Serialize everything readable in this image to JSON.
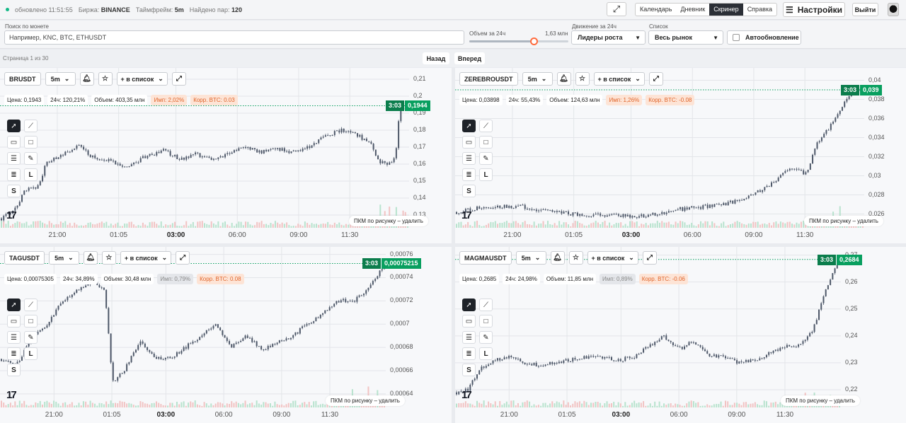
{
  "header": {
    "status": "обновлено 11:51:55",
    "exchange_label": "Биржа:",
    "exchange_value": "BINANCE",
    "timeframe_label": "Таймфрейм:",
    "timeframe_value": "5m",
    "pairs_label": "Найдено пар:",
    "pairs_value": "120",
    "tabs": [
      "Календарь",
      "Дневник",
      "Скринер",
      "Справка"
    ],
    "active_tab": "Скринер",
    "settings_label": "Настройки",
    "logout_label": "Выйти",
    "status_color": "#12b886"
  },
  "filters": {
    "search_label": "Поиск по монете",
    "search_placeholder": "Например, KNC, BTC, ETHUSDT",
    "volume_label": "Объем за 24ч",
    "volume_value": "1,63 млн",
    "volume_slider_fraction": 0.62,
    "movement_label": "Движение за 24ч",
    "movement_value": "Лидеры роста",
    "list_label": "Список",
    "list_value": "Весь рынок",
    "autoupdate_label": "Автообновление",
    "autoupdate_checked": false
  },
  "pagination": {
    "info": "Страница 1 из 30",
    "back": "Назад",
    "forward": "Вперед"
  },
  "chart_common": {
    "add_to_list": "+ в список",
    "hint": "ПКМ по рисунку – удалить",
    "x_ticks": [
      "21:00",
      "01:05",
      "03:00",
      "06:00",
      "09:00",
      "11:30"
    ],
    "bold_tick": "03:00",
    "up_color": "#089f5f",
    "candle_color": "#4d5768",
    "icons": [
      "bell-icon",
      "star-icon",
      "expand-icon",
      "cursor-icon",
      "line-icon",
      "calendar-icon",
      "rectangle-icon",
      "lines-icon",
      "pencil-icon",
      "text-align-icon",
      "l-tool-icon",
      "s-tool-icon"
    ]
  },
  "chart_data": [
    {
      "type": "candlestick",
      "symbol": "BRUSDT",
      "timeframe": "5m",
      "stats": {
        "price": "Цена: 0,1943",
        "change": "24ч: 120,21%",
        "volume": "Объем: 403,35 млн",
        "imp": "Имп: 2,02%",
        "corr": "Корр. BTC: 0.03"
      },
      "imp_style": "warn",
      "last_time": "3:03",
      "last_price": "0,1944",
      "last_value": 0.1944,
      "y_ticks": [
        "0,21",
        "0,2",
        "0,19",
        "0,18",
        "0,17",
        "0,16",
        "0,15",
        "0,14",
        "0,13"
      ],
      "ylim": [
        0.125,
        0.215
      ],
      "path": [
        [
          0,
          0.128
        ],
        [
          0.03,
          0.132
        ],
        [
          0.06,
          0.145
        ],
        [
          0.09,
          0.147
        ],
        [
          0.11,
          0.16
        ],
        [
          0.15,
          0.166
        ],
        [
          0.19,
          0.171
        ],
        [
          0.23,
          0.163
        ],
        [
          0.27,
          0.162
        ],
        [
          0.31,
          0.158
        ],
        [
          0.35,
          0.164
        ],
        [
          0.4,
          0.168
        ],
        [
          0.44,
          0.163
        ],
        [
          0.48,
          0.166
        ],
        [
          0.52,
          0.162
        ],
        [
          0.56,
          0.167
        ],
        [
          0.6,
          0.17
        ],
        [
          0.64,
          0.167
        ],
        [
          0.68,
          0.169
        ],
        [
          0.72,
          0.167
        ],
        [
          0.76,
          0.17
        ],
        [
          0.8,
          0.177
        ],
        [
          0.84,
          0.18
        ],
        [
          0.87,
          0.178
        ],
        [
          0.91,
          0.172
        ],
        [
          0.93,
          0.161
        ],
        [
          0.95,
          0.16
        ],
        [
          0.97,
          0.164
        ],
        [
          0.98,
          0.191
        ],
        [
          1.0,
          0.1944
        ]
      ]
    },
    {
      "type": "candlestick",
      "symbol": "ZEREBROUSDT",
      "timeframe": "5m",
      "stats": {
        "price": "Цена: 0,03898",
        "change": "24ч: 55,43%",
        "volume": "Объем: 124,63 млн",
        "imp": "Имп: 1,26%",
        "corr": "Корр. BTC: -0.08"
      },
      "imp_style": "warn",
      "last_time": "3:03",
      "last_price": "0,039",
      "last_value": 0.039,
      "y_ticks": [
        "0,04",
        "0,038",
        "0,036",
        "0,034",
        "0,032",
        "0,03",
        "0,028",
        "0,026"
      ],
      "ylim": [
        0.025,
        0.041
      ],
      "path": [
        [
          0,
          0.0262
        ],
        [
          0.04,
          0.0265
        ],
        [
          0.08,
          0.0268
        ],
        [
          0.12,
          0.0268
        ],
        [
          0.16,
          0.0268
        ],
        [
          0.2,
          0.0264
        ],
        [
          0.25,
          0.0262
        ],
        [
          0.3,
          0.0259
        ],
        [
          0.35,
          0.0259
        ],
        [
          0.4,
          0.0258
        ],
        [
          0.45,
          0.0258
        ],
        [
          0.5,
          0.026
        ],
        [
          0.55,
          0.0265
        ],
        [
          0.6,
          0.0267
        ],
        [
          0.65,
          0.027
        ],
        [
          0.7,
          0.0274
        ],
        [
          0.74,
          0.0283
        ],
        [
          0.77,
          0.0289
        ],
        [
          0.8,
          0.0301
        ],
        [
          0.83,
          0.0309
        ],
        [
          0.86,
          0.0302
        ],
        [
          0.89,
          0.0336
        ],
        [
          0.92,
          0.0352
        ],
        [
          0.95,
          0.0373
        ],
        [
          0.98,
          0.039
        ],
        [
          1.0,
          0.039
        ]
      ]
    },
    {
      "type": "candlestick",
      "symbol": "TAGUSDT",
      "timeframe": "5m",
      "stats": {
        "price": "Цена: 0,00075305",
        "change": "24ч: 34,89%",
        "volume": "Объем: 30,48 млн",
        "imp": "Имп: 0,79%",
        "corr": "Корр. BTC: 0.08"
      },
      "imp_style": "grey",
      "last_time": "3:03",
      "last_price": "0,00075215",
      "last_value": 0.00075215,
      "y_ticks": [
        "0,00076",
        "0,00074",
        "0,00072",
        "0,0007",
        "0,00068",
        "0,00066",
        "0,00064"
      ],
      "ylim": [
        0.000632,
        0.000764
      ],
      "path": [
        [
          0,
          0.00067
        ],
        [
          0.04,
          0.000665
        ],
        [
          0.08,
          0.00069
        ],
        [
          0.12,
          0.0007
        ],
        [
          0.16,
          0.00072
        ],
        [
          0.2,
          0.00073
        ],
        [
          0.24,
          0.000736
        ],
        [
          0.27,
          0.00073
        ],
        [
          0.29,
          0.00065
        ],
        [
          0.32,
          0.00066
        ],
        [
          0.36,
          0.000685
        ],
        [
          0.4,
          0.000672
        ],
        [
          0.44,
          0.00067
        ],
        [
          0.48,
          0.00068
        ],
        [
          0.52,
          0.00069
        ],
        [
          0.56,
          0.0007
        ],
        [
          0.6,
          0.00068
        ],
        [
          0.64,
          0.00069
        ],
        [
          0.68,
          0.000678
        ],
        [
          0.72,
          0.000684
        ],
        [
          0.76,
          0.00069
        ],
        [
          0.8,
          0.0007
        ],
        [
          0.84,
          0.00071
        ],
        [
          0.88,
          0.00072
        ],
        [
          0.92,
          0.00072
        ],
        [
          0.96,
          0.00073
        ],
        [
          1.0,
          0.000752
        ]
      ]
    },
    {
      "type": "candlestick",
      "symbol": "MAGMAUSDT",
      "timeframe": "5m",
      "stats": {
        "price": "Цена: 0,2685",
        "change": "24ч: 24,98%",
        "volume": "Объем: 11,85 млн",
        "imp": "Имп: 0,89%",
        "corr": "Корр. BTC: -0.06"
      },
      "imp_style": "grey",
      "last_time": "3:03",
      "last_price": "0,2684",
      "last_value": 0.2684,
      "y_ticks": [
        "0,27",
        "0,26",
        "0,25",
        "0,24",
        "0,23",
        "0,22"
      ],
      "ylim": [
        0.215,
        0.272
      ],
      "path": [
        [
          0,
          0.219
        ],
        [
          0.03,
          0.22
        ],
        [
          0.06,
          0.228
        ],
        [
          0.1,
          0.231
        ],
        [
          0.14,
          0.232
        ],
        [
          0.18,
          0.23
        ],
        [
          0.22,
          0.229
        ],
        [
          0.26,
          0.23
        ],
        [
          0.3,
          0.231
        ],
        [
          0.34,
          0.232
        ],
        [
          0.38,
          0.232
        ],
        [
          0.42,
          0.231
        ],
        [
          0.46,
          0.232
        ],
        [
          0.5,
          0.236
        ],
        [
          0.54,
          0.24
        ],
        [
          0.58,
          0.235
        ],
        [
          0.62,
          0.238
        ],
        [
          0.66,
          0.233
        ],
        [
          0.7,
          0.232
        ],
        [
          0.74,
          0.23
        ],
        [
          0.78,
          0.231
        ],
        [
          0.82,
          0.234
        ],
        [
          0.86,
          0.236
        ],
        [
          0.9,
          0.237
        ],
        [
          0.93,
          0.242
        ],
        [
          0.96,
          0.255
        ],
        [
          0.98,
          0.263
        ],
        [
          1.0,
          0.2684
        ]
      ]
    }
  ]
}
